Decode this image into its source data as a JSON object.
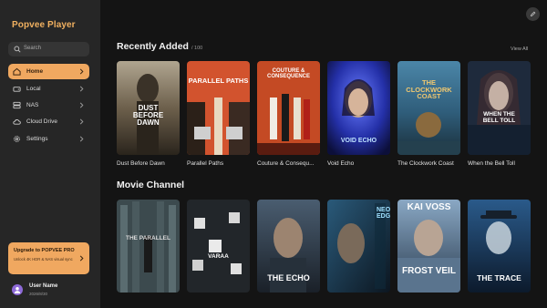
{
  "app": {
    "title": "Popvee Player"
  },
  "search": {
    "placeholder": "Search"
  },
  "nav": [
    {
      "label": "Home",
      "icon": "home-icon",
      "active": true
    },
    {
      "label": "Local",
      "icon": "local-drive-icon"
    },
    {
      "label": "NAS",
      "icon": "nas-icon"
    },
    {
      "label": "Cloud Drive",
      "icon": "cloud-icon"
    },
    {
      "label": "Settings",
      "icon": "gear-icon"
    }
  ],
  "promo": {
    "title": "Upgrade to POPVEE PRO",
    "text": "Unlock 4K HDR & NAS visual sync"
  },
  "user": {
    "name": "User Name",
    "date": "2026/8/30"
  },
  "recent": {
    "title": "Recently Added",
    "count": "/ 100",
    "view_all": "View All",
    "items": [
      {
        "title": "Dust Before Dawn",
        "poster_text": "DUST BEFORE DAWN"
      },
      {
        "title": "Parallel Paths",
        "poster_text": "PARALLEL PATHS"
      },
      {
        "title": "Couture & Consequence",
        "display_title": "Couture & Consequ...",
        "poster_text": "COUTURE & CONSEQUENCE"
      },
      {
        "title": "Void Echo",
        "poster_text": "VOID ECHO"
      },
      {
        "title": "The Clockwork Coast",
        "poster_text": "THE CLOCKWORK COAST"
      },
      {
        "title": "When the Bell Toll",
        "poster_text": "WHEN THE BELL TOLL"
      }
    ]
  },
  "channel": {
    "title": "Movie Channel",
    "items": [
      {
        "poster_text": "THE PARALLEL"
      },
      {
        "poster_text": "VARAA"
      },
      {
        "poster_text": "THE ECHO"
      },
      {
        "poster_text": "NEON EDGE"
      },
      {
        "poster_text": "KAI VOSS",
        "poster_text_2": "FROST VEIL"
      },
      {
        "poster_text": "THE TRACE"
      }
    ]
  },
  "colors": {
    "accent": "#f0a860",
    "sidebar": "#262626",
    "background": "#141414",
    "avatar": "#8e6ad8"
  }
}
